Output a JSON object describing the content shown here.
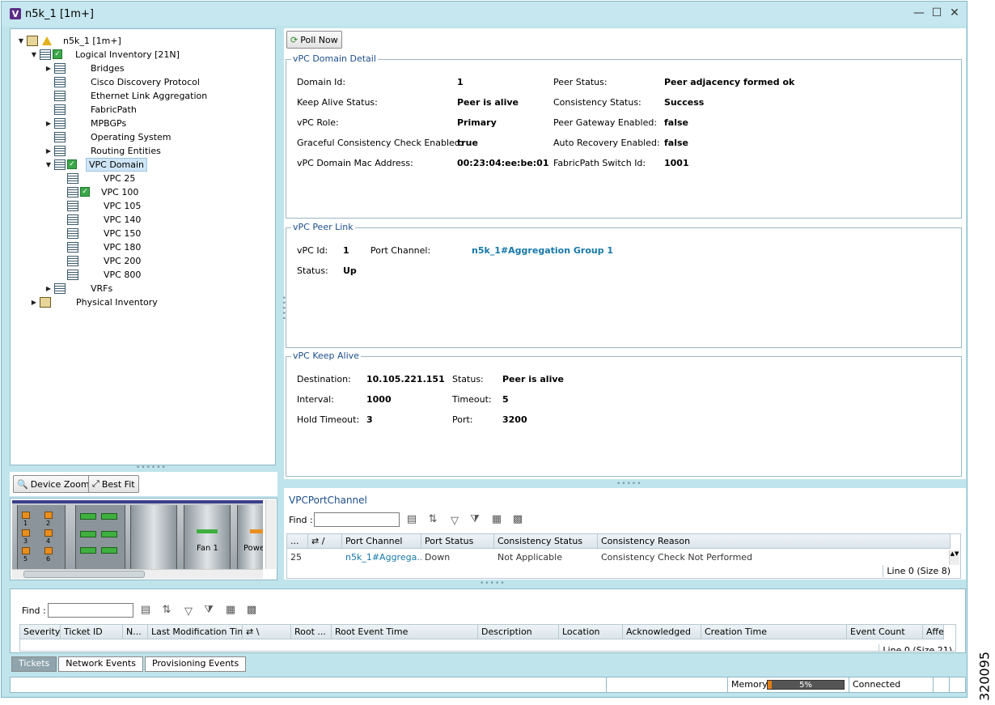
{
  "window": {
    "title": "n5k_1 [1m+]",
    "minimize_label": "—",
    "maximize_label": "☐",
    "close_label": "✕"
  },
  "tree": {
    "root": "n5k_1 [1m+]",
    "logical": "Logical Inventory [21N]",
    "items": [
      "Bridges",
      "Cisco Discovery Protocol",
      "Ethernet Link Aggregation",
      "FabricPath",
      "MPBGPs",
      "Operating System",
      "Routing Entities",
      "VPC Domain"
    ],
    "vpc_children": [
      "VPC 25",
      "VPC 100",
      "VPC 105",
      "VPC 140",
      "VPC 150",
      "VPC 180",
      "VPC 200",
      "VPC 800"
    ],
    "vrfs": "VRFs",
    "physical": "Physical Inventory"
  },
  "navigator": {
    "device_zoom": "Device Zoom",
    "best_fit": "Best Fit",
    "fan_label": "Fan 1",
    "pow_label": "Powe",
    "port_labels": [
      "1",
      "2",
      "3",
      "4",
      "5",
      "6"
    ]
  },
  "toolbar": {
    "poll_now": "Poll Now"
  },
  "vpc_domain": {
    "title": "vPC Domain Detail",
    "domain_id_label": "Domain Id:",
    "domain_id": "1",
    "keepalive_status_label": "Keep Alive Status:",
    "keepalive_status": "Peer is alive",
    "role_label": "vPC Role:",
    "role": "Primary",
    "graceful_label": "Graceful Consistency Check Enabled:",
    "graceful": "true",
    "mac_label": "vPC Domain Mac Address:",
    "mac": "00:23:04:ee:be:01",
    "peer_status_label": "Peer Status:",
    "peer_status": "Peer adjacency formed ok",
    "consistency_label": "Consistency Status:",
    "consistency": "Success",
    "peer_gw_label": "Peer Gateway Enabled:",
    "peer_gw": "false",
    "auto_recovery_label": "Auto Recovery Enabled:",
    "auto_recovery": "false",
    "fabricpath_label": "FabricPath Switch Id:",
    "fabricpath": "1001"
  },
  "peer_link": {
    "title": "vPC Peer Link",
    "vpc_id_label": "vPC Id:",
    "vpc_id": "1",
    "port_channel_label": "Port Channel:",
    "port_channel": "n5k_1#Aggregation Group 1",
    "status_label": "Status:",
    "status": "Up"
  },
  "keep_alive": {
    "title": "vPC Keep Alive",
    "destination_label": "Destination:",
    "destination": "10.105.221.151",
    "interval_label": "Interval:",
    "interval": "1000",
    "hold_timeout_label": "Hold Timeout:",
    "hold_timeout": "3",
    "status_label": "Status:",
    "status": "Peer is alive",
    "timeout_label": "Timeout:",
    "timeout": "5",
    "port_label": "Port:",
    "port": "3200"
  },
  "port_channel_table": {
    "title": "VPCPortChannel",
    "find_label": "Find :",
    "columns": [
      "...",
      "⇄ /",
      "Port Channel",
      "Port Status",
      "Consistency Status",
      "Consistency Reason"
    ],
    "rows": [
      [
        "25",
        "",
        "n5k_1#Aggrega...",
        "Down",
        "Not Applicable",
        "Consistency Check Not Performed"
      ]
    ],
    "footer": "Line 0 (Size 8)"
  },
  "tickets_table": {
    "find_label": "Find :",
    "columns": [
      "Severity",
      "Ticket ID",
      "N...",
      "Last Modification Time",
      "⇄ \\",
      "Root ...",
      "Root Event Time",
      "Description",
      "Location",
      "Acknowledged",
      "Creation Time",
      "Event Count",
      "Affe"
    ],
    "footer": "Line 0 (Size 21)"
  },
  "tabs": [
    "Tickets",
    "Network Events",
    "Provisioning Events"
  ],
  "status_bar": {
    "memory_label": "Memory:",
    "memory_value": "5%",
    "memory_fraction": 0.05,
    "connection": "Connected"
  },
  "side_code": "320095"
}
